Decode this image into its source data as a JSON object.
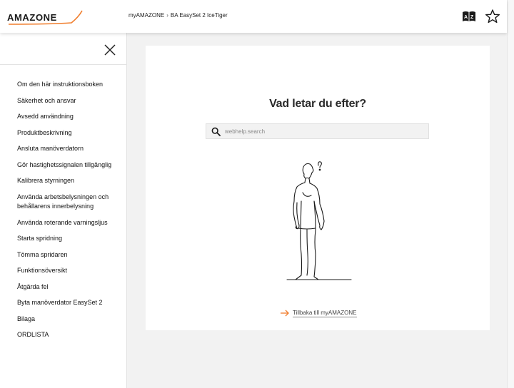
{
  "header": {
    "logo_text": "AMAZONE",
    "breadcrumb": [
      "myAMAZONE",
      "BA EasySet 2 IceTiger"
    ],
    "breadcrumb_separator": "›",
    "icons": [
      "dictionary-icon",
      "star-icon"
    ]
  },
  "sidebar": {
    "close_icon": "close-icon",
    "items": [
      "Om den här instruktionsboken",
      "Säkerhet och ansvar",
      "Avsedd användning",
      "Produktbeskrivning",
      "Ansluta manöverdatorn",
      "Gör hastighetssignalen tillgänglig",
      "Kalibrera styrningen",
      "Använda arbetsbelysningen och behållarens innerbelysning",
      "Använda roterande varningsljus",
      "Starta spridning",
      "Tömma spridaren",
      "Funktionsöversikt",
      "Åtgärda fel",
      "Byta manöverdator EasySet 2",
      "Bilaga",
      "ORDLISTA"
    ]
  },
  "main": {
    "title": "Vad letar du efter?",
    "search": {
      "placeholder": "webhelp.search",
      "value": ""
    },
    "back_link": "Tillbaka till myAMAZONE"
  },
  "colors": {
    "accent_orange": "#f07d2c",
    "text_dark": "#222222",
    "background": "#f2f2f2"
  }
}
